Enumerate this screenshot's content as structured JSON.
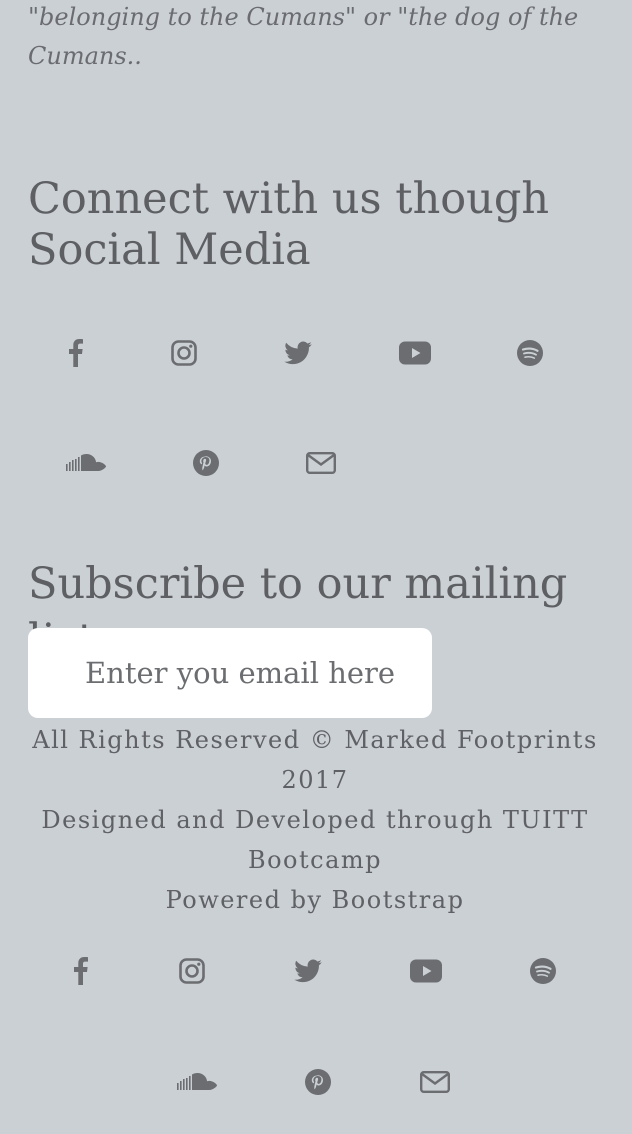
{
  "intro": {
    "quote": "\"belonging to the Cumans\" or \"the dog of the Cumans.."
  },
  "connect": {
    "heading": "Connect with us though Social Media",
    "icons": [
      "facebook-icon",
      "instagram-icon",
      "twitter-icon",
      "youtube-icon",
      "spotify-icon",
      "soundcloud-icon",
      "pinterest-icon",
      "envelope-icon"
    ]
  },
  "subscribe": {
    "heading": "Subscribe to our mailing list",
    "email_placeholder": "Enter you email here"
  },
  "footer": {
    "rights": "All Rights Reserved © Marked Footprints 2017",
    "designed": "Designed and Developed through TUITT Bootcamp",
    "powered": "Powered by Bootstrap",
    "icons": [
      "facebook-icon",
      "instagram-icon",
      "twitter-icon",
      "youtube-icon",
      "spotify-icon",
      "soundcloud-icon",
      "pinterest-icon",
      "envelope-icon"
    ]
  },
  "colors": {
    "background": "#cbd0d5",
    "text": "#5f6164",
    "input_background": "#ffffff"
  }
}
